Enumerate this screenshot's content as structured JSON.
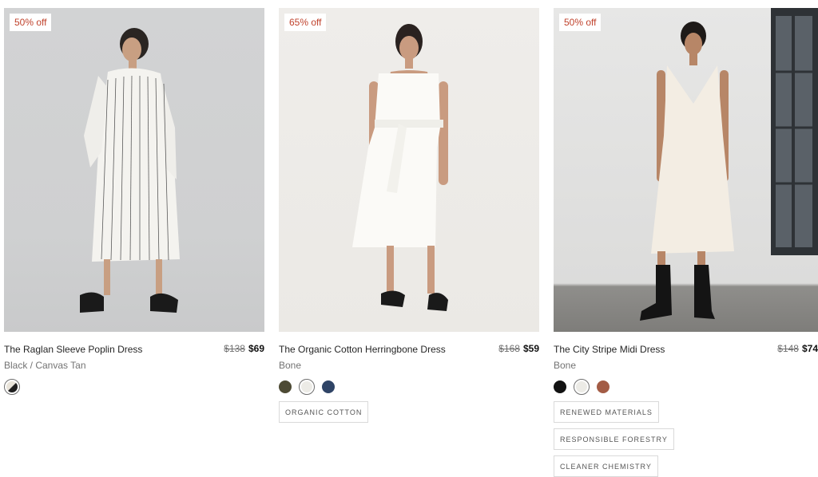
{
  "products": [
    {
      "discount": "50% off",
      "name": "The Raglan Sleeve Poplin Dress",
      "old_price": "$138",
      "new_price": "$69",
      "color_name": "Black / Canvas Tan",
      "swatches": [
        {
          "color": "#1f1f1f",
          "color2": "#e9e4da",
          "selected": true
        }
      ],
      "tags": []
    },
    {
      "discount": "65% off",
      "name": "The Organic Cotton Herringbone Dress",
      "old_price": "$168",
      "new_price": "$59",
      "color_name": "Bone",
      "swatches": [
        {
          "color": "#4d4a34",
          "selected": false
        },
        {
          "color": "#ecebe6",
          "selected": true
        },
        {
          "color": "#2f4466",
          "selected": false
        }
      ],
      "tags": [
        "ORGANIC COTTON"
      ]
    },
    {
      "discount": "50% off",
      "name": "The City Stripe Midi Dress",
      "old_price": "$148",
      "new_price": "$74",
      "color_name": "Bone",
      "swatches": [
        {
          "color": "#121212",
          "selected": false
        },
        {
          "color": "#ecebe6",
          "selected": true
        },
        {
          "color": "#a35c45",
          "selected": false
        }
      ],
      "tags": [
        "RENEWED MATERIALS",
        "RESPONSIBLE FORESTRY",
        "CLEANER CHEMISTRY"
      ]
    }
  ],
  "colors": {
    "badge_text": "#c0422c",
    "price_old": "#6f6f6f",
    "tag_border": "#d9d9d9"
  },
  "images": [
    {
      "subject": "model in white striped poplin dress with black slides"
    },
    {
      "subject": "model in white sleeveless herringbone dress with black slides"
    },
    {
      "subject": "model in white midi slip dress with black boots"
    }
  ]
}
